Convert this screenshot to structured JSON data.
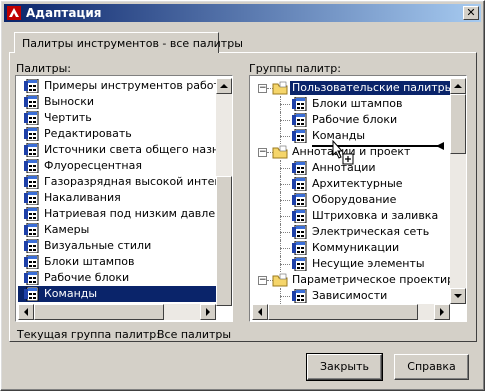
{
  "window": {
    "title": "Адаптация",
    "close_glyph": "✕"
  },
  "tab": {
    "label": "Палитры инструментов - все палитры"
  },
  "palettes": {
    "label": "Палитры:",
    "items": [
      {
        "label": "Примеры инструментов работы с"
      },
      {
        "label": "Выноски"
      },
      {
        "label": "Чертить"
      },
      {
        "label": "Редактировать"
      },
      {
        "label": "Источники света общего назначен"
      },
      {
        "label": "Флуоресцентная"
      },
      {
        "label": "Газоразрядная высокой интенсив"
      },
      {
        "label": "Накаливания"
      },
      {
        "label": "Натриевая под низким давлением"
      },
      {
        "label": "Камеры"
      },
      {
        "label": "Визуальные стили"
      },
      {
        "label": "Блоки штампов"
      },
      {
        "label": "Рабочие блоки"
      },
      {
        "label": "Команды"
      }
    ],
    "selected": "Команды"
  },
  "groups": {
    "label": "Группы палитр:",
    "tree": [
      {
        "label": "Пользовательские палитры",
        "type": "folder",
        "level": 0,
        "expanded": true,
        "selected": true
      },
      {
        "label": "Блоки штампов",
        "type": "palette",
        "level": 1
      },
      {
        "label": "Рабочие блоки",
        "type": "palette",
        "level": 1
      },
      {
        "label": "Команды",
        "type": "palette",
        "level": 1
      },
      {
        "label": "Аннотации и проект",
        "type": "folder",
        "level": 0,
        "expanded": true
      },
      {
        "label": "Аннотации",
        "type": "palette",
        "level": 1
      },
      {
        "label": "Архитектурные",
        "type": "palette",
        "level": 1
      },
      {
        "label": "Оборудование",
        "type": "palette",
        "level": 1
      },
      {
        "label": "Штриховка и заливка",
        "type": "palette",
        "level": 1
      },
      {
        "label": "Электрическая сеть",
        "type": "palette",
        "level": 1
      },
      {
        "label": "Коммуникации",
        "type": "palette",
        "level": 1
      },
      {
        "label": "Несущие элементы",
        "type": "palette",
        "level": 1
      },
      {
        "label": "Параметрическое проектирова",
        "type": "folder",
        "level": 0,
        "expanded": true
      },
      {
        "label": "Зависимости",
        "type": "palette",
        "level": 1
      }
    ]
  },
  "current_group": {
    "label": "Текущая группа палитр:",
    "value": "Все палитры"
  },
  "buttons": {
    "close": "Закрыть",
    "help": "Справка"
  },
  "colors": {
    "title_start": "#0a246a",
    "title_end": "#a6caf0",
    "selection": "#0a246a",
    "face": "#d4d0c8"
  },
  "icons": {
    "palette": "palette-icon",
    "folder": "folder-icon",
    "drag_cursor": "drag-copy-cursor-icon"
  }
}
